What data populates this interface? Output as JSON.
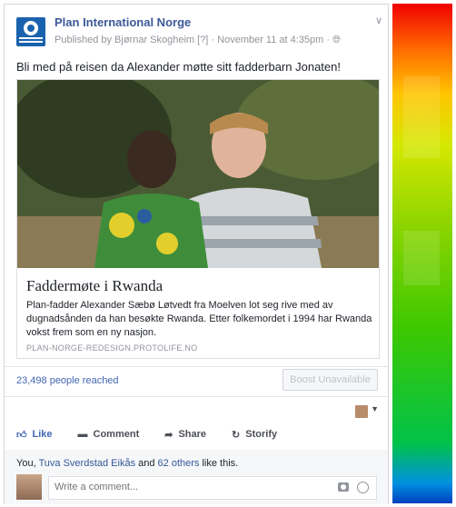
{
  "post": {
    "page_name": "Plan International Norge",
    "meta": "Published by Bjørnar Skogheim [?] · November 11 at 4:35pm · ",
    "text": "Bli med på reisen da Alexander møtte sitt fadderbarn Jonaten!"
  },
  "link": {
    "title": "Faddermøte i Rwanda",
    "desc_lines": [
      "Plan-fadder Alexander Sæbø Løtvedt fra Moelven lot seg rive med av",
      "dugnadsånden da han besøkte Rwanda. Etter folkemordet i 1994 har Rwanda",
      "vokst frem som en ny nasjon."
    ],
    "domain": "PLAN-NORGE-REDESIGN.PROTOLIFE.NO"
  },
  "insights": {
    "reach": "23,498 people reached",
    "boost": "Boost Unavailable"
  },
  "actions": {
    "like": "Like",
    "comment": "Comment",
    "share": "Share",
    "storify": "Storify"
  },
  "social": {
    "prefix": "You, ",
    "name": "Tuva Sverdstad Eikås",
    "mid": " and ",
    "others": "62 others",
    "suffix": " like this."
  },
  "comment": {
    "placeholder": "Write a comment..."
  },
  "colors": {
    "brand": "#3b5998",
    "link_blue": "#4267b2",
    "logo_blue": "#1a62ae"
  },
  "icons": [
    "globe-icon",
    "chevron-down-icon",
    "like-icon",
    "comment-icon",
    "share-icon",
    "storify-icon",
    "camera-icon",
    "smiley-icon"
  ]
}
